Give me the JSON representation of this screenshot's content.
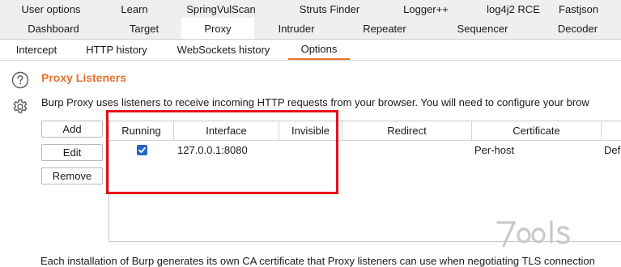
{
  "extension_tabs": [
    "User options",
    "Learn",
    "SpringVulScan",
    "Struts Finder",
    "Logger++",
    "log4j2 RCE",
    "Fastjson"
  ],
  "main_tabs": [
    "Dashboard",
    "Target",
    "Proxy",
    "Intruder",
    "Repeater",
    "Sequencer",
    "Decoder"
  ],
  "main_tab_active": "Proxy",
  "sub_tabs": [
    "Intercept",
    "HTTP history",
    "WebSockets history",
    "Options"
  ],
  "sub_tab_active": "Options",
  "section": {
    "title": "Proxy Listeners",
    "description": "Burp Proxy uses listeners to receive incoming HTTP requests from your browser. You will need to configure your brow"
  },
  "buttons": {
    "add": "Add",
    "edit": "Edit",
    "remove": "Remove"
  },
  "table": {
    "columns": [
      "Running",
      "Interface",
      "Invisible",
      "Redirect",
      "Certificate",
      ""
    ],
    "rows": [
      {
        "running": true,
        "interface": "127.0.0.1:8080",
        "invisible": "",
        "redirect": "",
        "certificate": "Per-host",
        "extra": "Def"
      }
    ]
  },
  "footer_text": "Each installation of Burp generates its own CA certificate that Proxy listeners can use when negotiating TLS connection",
  "colors": {
    "accent": "#e8702a",
    "highlight": "#e8101a",
    "checkbox": "#2866c4"
  },
  "icons": {
    "help": "help-circle-icon",
    "settings": "gear-icon",
    "watermark": "7ools-watermark"
  }
}
